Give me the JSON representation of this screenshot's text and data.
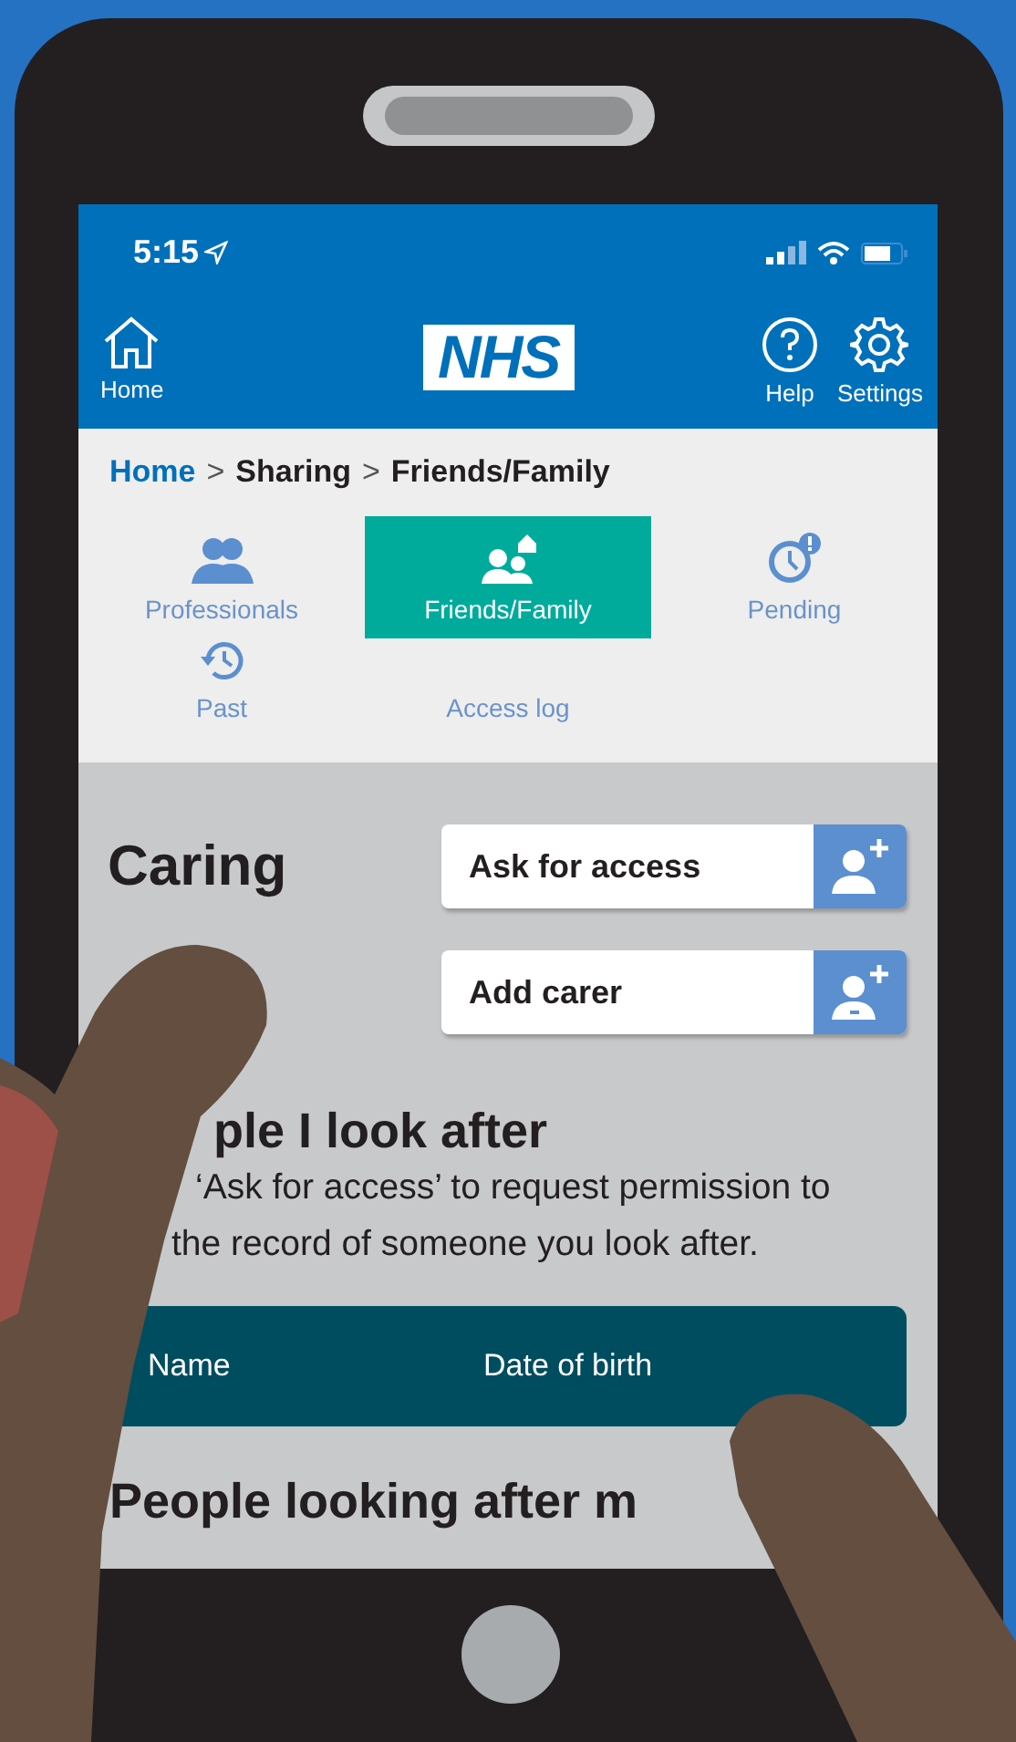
{
  "status_bar": {
    "time": "5:15"
  },
  "header": {
    "home": {
      "label": "Home"
    },
    "logo": "NHS",
    "actions": [
      {
        "label": "Help",
        "kind": "help"
      },
      {
        "label": "Settings",
        "kind": "settings"
      }
    ]
  },
  "breadcrumb": {
    "separator": ">",
    "items": [
      {
        "label": "Home",
        "kind": "link"
      },
      {
        "label": "Sharing",
        "kind": "text"
      },
      {
        "label": "Friends/Family",
        "kind": "text"
      }
    ]
  },
  "tabs": [
    {
      "label": "Professionals",
      "kind": "professionals",
      "selected": false
    },
    {
      "label": "Friends/Family",
      "kind": "friends",
      "selected": true
    },
    {
      "label": "Pending",
      "kind": "pending",
      "selected": false
    },
    {
      "label": "Past",
      "kind": "past",
      "selected": false
    },
    {
      "label": "Access log",
      "kind": "plain",
      "selected": false
    }
  ],
  "caring": {
    "title": "Caring",
    "buttons": [
      {
        "label": "Ask for access",
        "kind": "ask"
      },
      {
        "label": "Add carer",
        "kind": "add"
      }
    ]
  },
  "people_i_look_after": {
    "heading": "ple I look after",
    "description": [
      "‘Ask for access’ to request permission to",
      "the record of someone you look after."
    ],
    "table": {
      "columns": [
        "Name",
        "Date of birth"
      ]
    }
  },
  "people_looking_after_me": {
    "heading": "People looking after m"
  }
}
